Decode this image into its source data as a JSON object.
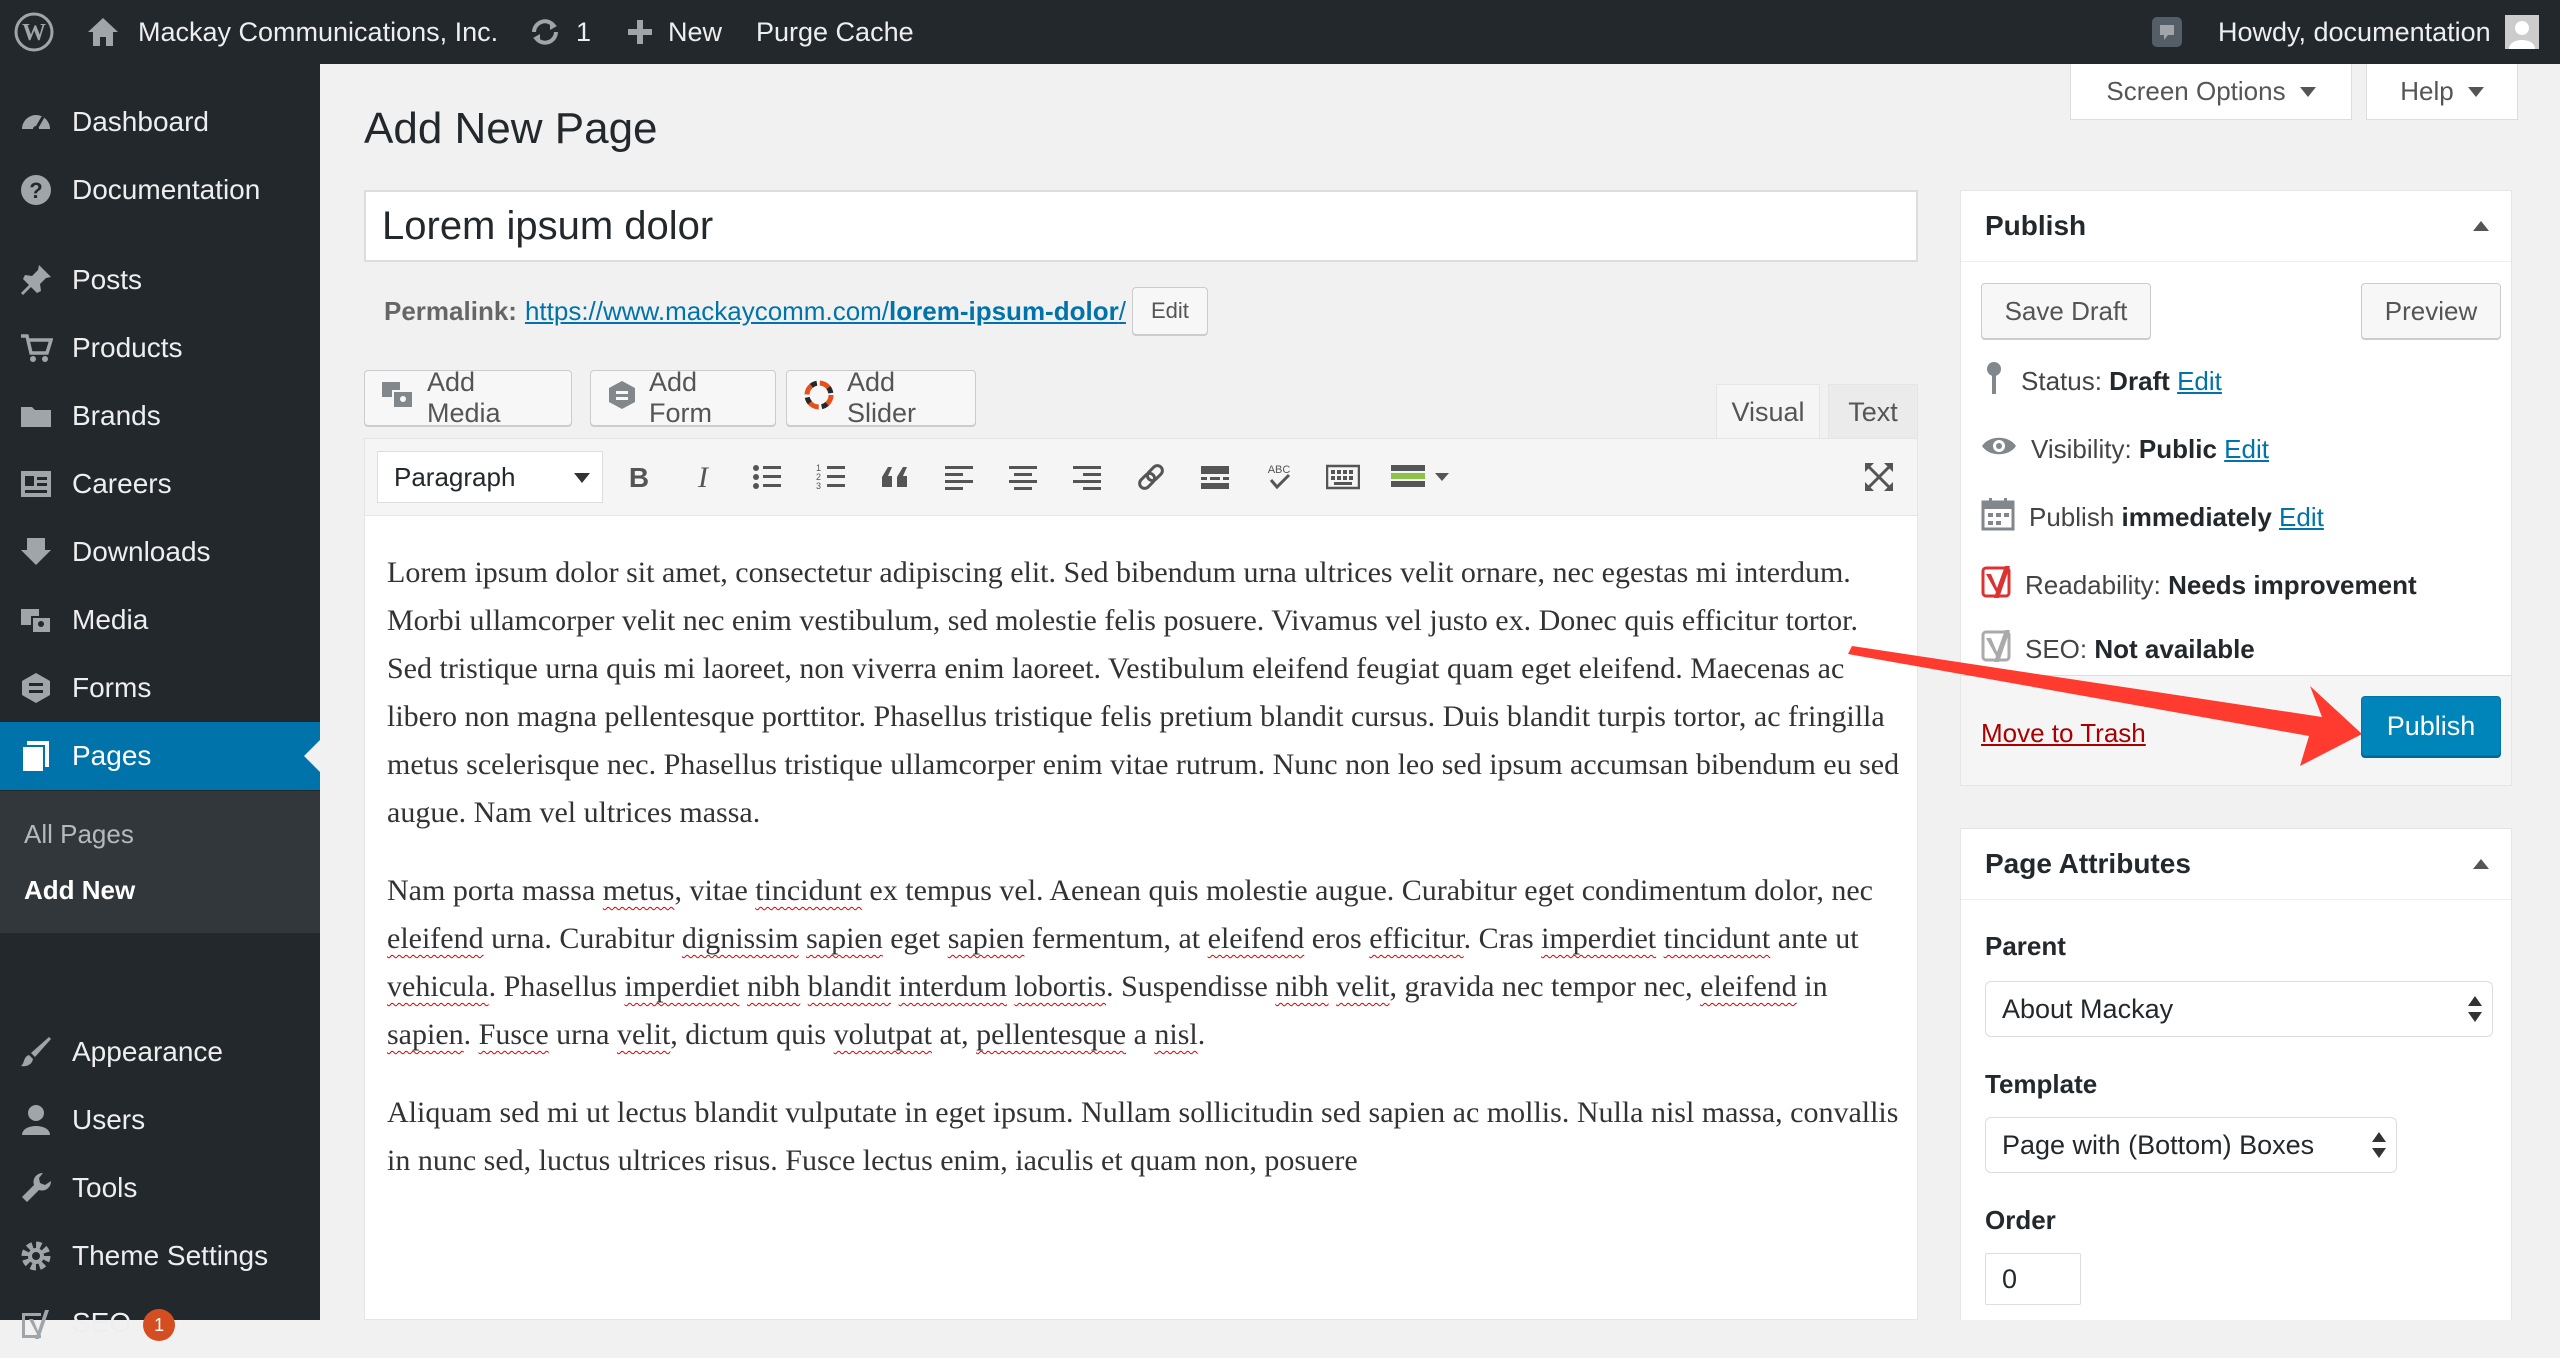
{
  "adminbar": {
    "site_name": "Mackay Communications, Inc.",
    "updates_count": "1",
    "new_label": "New",
    "purge_cache": "Purge Cache",
    "howdy": "Howdy, documentation"
  },
  "sidebar": {
    "items": [
      {
        "label": "Dashboard",
        "icon": "dashboard-icon"
      },
      {
        "label": "Documentation",
        "icon": "help-icon"
      },
      {
        "label": "Posts",
        "icon": "pin-icon"
      },
      {
        "label": "Products",
        "icon": "cart-icon"
      },
      {
        "label": "Brands",
        "icon": "folder-icon"
      },
      {
        "label": "Careers",
        "icon": "id-card-icon"
      },
      {
        "label": "Downloads",
        "icon": "download-icon"
      },
      {
        "label": "Media",
        "icon": "media-icon"
      },
      {
        "label": "Forms",
        "icon": "forms-icon"
      },
      {
        "label": "Pages",
        "icon": "pages-icon"
      },
      {
        "label": "Appearance",
        "icon": "brush-icon"
      },
      {
        "label": "Users",
        "icon": "user-icon"
      },
      {
        "label": "Tools",
        "icon": "wrench-icon"
      },
      {
        "label": "Theme Settings",
        "icon": "gear-icon"
      },
      {
        "label": "SEO",
        "icon": "yoast-icon",
        "badge": "1"
      }
    ],
    "submenu": [
      "All Pages",
      "Add New"
    ]
  },
  "screen_options": "Screen Options",
  "help": "Help",
  "page_title": "Add New Page",
  "post_title": "Lorem ipsum dolor",
  "permalink": {
    "label": "Permalink:",
    "url_base": "https://www.mackaycomm.com/",
    "slug": "lorem-ipsum-dolor",
    "url_end": "/",
    "edit": "Edit"
  },
  "media_buttons": {
    "add_media": "Add Media",
    "add_form": "Add Form",
    "add_slider": "Add Slider"
  },
  "editor_tabs": {
    "visual": "Visual",
    "text": "Text"
  },
  "format_select": "Paragraph",
  "content": {
    "p1": "Lorem ipsum dolor sit amet, consectetur adipiscing elit. Sed bibendum urna ultrices velit ornare, nec egestas mi interdum. Morbi ullamcorper velit nec enim vestibulum, sed molestie felis posuere. Vivamus vel justo ex. Donec quis efficitur tortor. Sed tristique urna quis mi laoreet, non viverra enim laoreet. Vestibulum eleifend feugiat quam eget eleifend. Maecenas ac libero non magna pellentesque porttitor. Phasellus tristique felis pretium blandit cursus. Duis blandit turpis tortor, ac fringilla metus scelerisque nec. Phasellus tristique ullamcorper enim vitae rutrum. Nunc non leo sed ipsum accumsan bibendum eu sed augue. Nam vel ultrices massa.",
    "p3": "Aliquam sed mi ut lectus blandit vulputate in eget ipsum. Nullam sollicitudin sed sapien ac mollis. Nulla nisl massa, convallis in nunc sed, luctus ultrices risus. Fusce lectus enim, iaculis et quam non, posuere"
  },
  "publish_box": {
    "title": "Publish",
    "save_draft": "Save Draft",
    "preview": "Preview",
    "status_label": "Status:",
    "status_value": "Draft",
    "visibility_label": "Visibility:",
    "visibility_value": "Public",
    "publish_label": "Publish",
    "publish_value": "immediately",
    "readability_label": "Readability:",
    "readability_value": "Needs improvement",
    "seo_label": "SEO:",
    "seo_value": "Not available",
    "edit": "Edit",
    "trash": "Move to Trash",
    "publish_button": "Publish"
  },
  "attributes_box": {
    "title": "Page Attributes",
    "parent_label": "Parent",
    "parent_value": "About Mackay",
    "template_label": "Template",
    "template_value": "Page with (Bottom) Boxes",
    "order_label": "Order",
    "order_value": "0"
  },
  "colors": {
    "admin_dark": "#23282d",
    "accent_blue": "#0073aa",
    "publish_blue": "#0085ba",
    "annotation_red": "#ff3b2f"
  }
}
